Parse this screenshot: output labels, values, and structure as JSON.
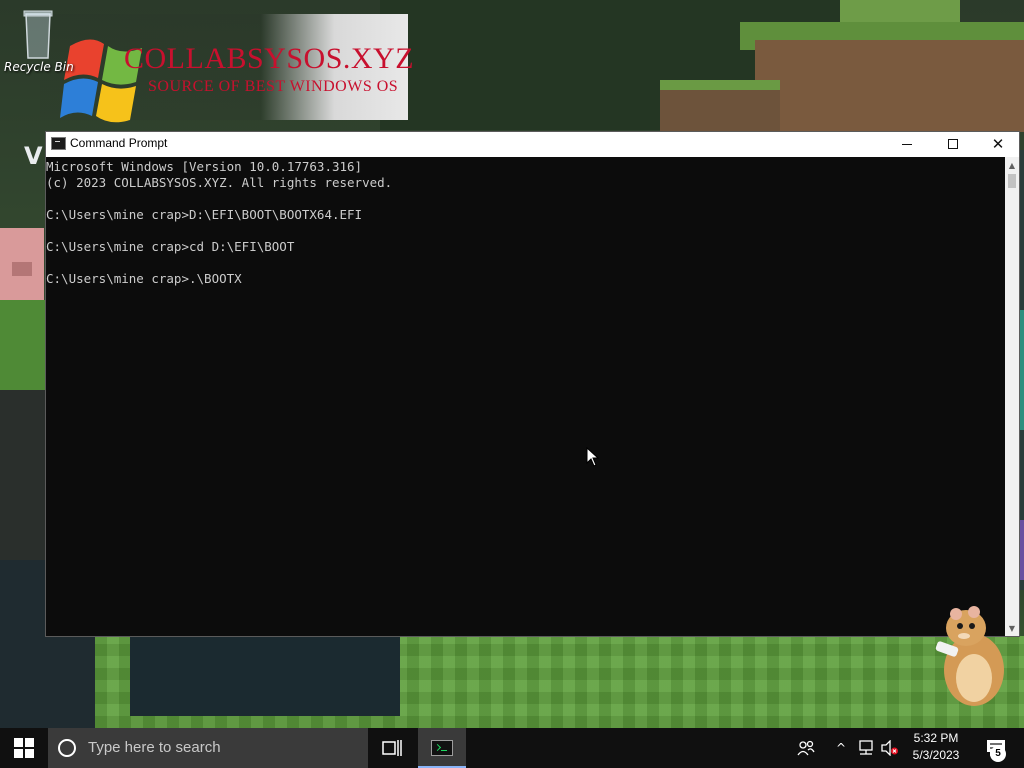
{
  "desktop": {
    "recycle_bin_label": "Recycle Bin",
    "banner": {
      "title": "COLLABSYSOS.XYZ",
      "subtitle": "SOURCE OF BEST WINDOWS OS",
      "title_color": "#c8102e"
    }
  },
  "window": {
    "title": "Command Prompt",
    "icon": "cmd-icon",
    "controls": {
      "minimize": "minimize-icon",
      "maximize": "maximize-icon",
      "close": "close-icon"
    },
    "lines": [
      "Microsoft Windows [Version 10.0.17763.316]",
      "(c) 2023 COLLABSYSOS.XYZ. All rights reserved.",
      "",
      "C:\\Users\\mine crap>D:\\EFI\\BOOT\\BOOTX64.EFI",
      "",
      "C:\\Users\\mine crap>cd D:\\EFI\\BOOT",
      "",
      "C:\\Users\\mine crap>.\\BOOTX"
    ],
    "text_color": "#cccccc",
    "background": "#0c0c0c"
  },
  "taskbar": {
    "start_icon": "windows-logo-icon",
    "search_placeholder": "Type here to search",
    "taskview_icon": "task-view-icon",
    "pinned_app_icon": "command-prompt-icon",
    "tray": {
      "people_icon": "people-icon",
      "chevron_icon": "chevron-up-icon",
      "network_icon": "network-icon",
      "volume_icon": "volume-muted-icon"
    },
    "clock": {
      "time": "5:32 PM",
      "date": "5/3/2023"
    },
    "notification_count": "5"
  }
}
